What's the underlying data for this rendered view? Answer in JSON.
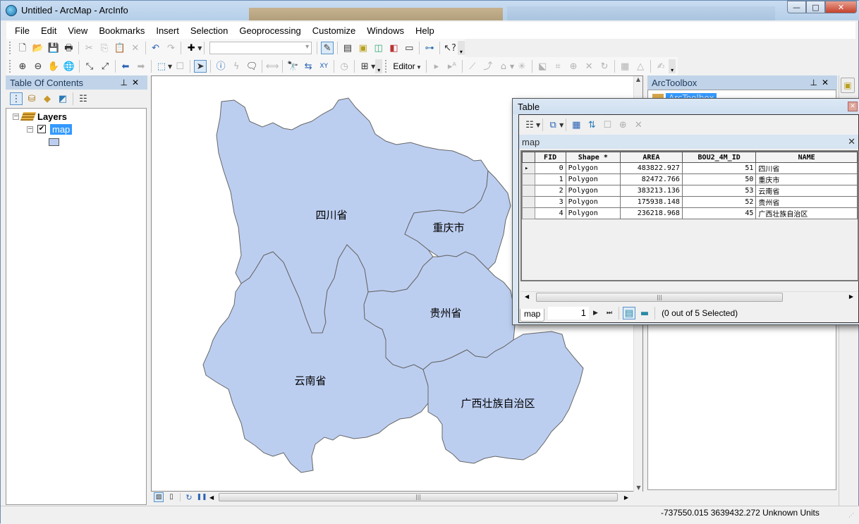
{
  "window": {
    "title": "Untitled - ArcMap - ArcInfo",
    "controls": {
      "minimize": "—",
      "maximize": "□",
      "close": "✕"
    }
  },
  "menu": [
    "File",
    "Edit",
    "View",
    "Bookmarks",
    "Insert",
    "Selection",
    "Geoprocessing",
    "Customize",
    "Windows",
    "Help"
  ],
  "toolbar": {
    "editor_label": "Editor",
    "scale_value": ""
  },
  "toc": {
    "title": "Table Of Contents",
    "root_label": "Layers",
    "layer_label": "map",
    "layer_checked": true,
    "symbol_color": "#bccef0"
  },
  "map": {
    "fill_color": "#bccef0",
    "stroke_color": "#666666",
    "labels": [
      "四川省",
      "重庆市",
      "贵州省",
      "云南省",
      "广西壮族自治区"
    ]
  },
  "toolbox": {
    "title": "ArcToolbox",
    "root_label": "ArcToolbox"
  },
  "table_window": {
    "title": "Table",
    "tab_header": "map",
    "columns": [
      "FID",
      "Shape *",
      "AREA",
      "BOU2_4M_ID",
      "NAME"
    ],
    "rows": [
      {
        "fid": "0",
        "shape": "Polygon",
        "area": "483822.927",
        "bou2": "51",
        "name": "四川省",
        "current": true
      },
      {
        "fid": "1",
        "shape": "Polygon",
        "area": "82472.766",
        "bou2": "50",
        "name": "重庆市",
        "current": false
      },
      {
        "fid": "2",
        "shape": "Polygon",
        "area": "383213.136",
        "bou2": "53",
        "name": "云南省",
        "current": false
      },
      {
        "fid": "3",
        "shape": "Polygon",
        "area": "175938.148",
        "bou2": "52",
        "name": "贵州省",
        "current": false
      },
      {
        "fid": "4",
        "shape": "Polygon",
        "area": "236218.968",
        "bou2": "45",
        "name": "广西壮族自治区",
        "current": false
      }
    ],
    "current_record": "1",
    "selection_status": "(0 out of 5 Selected)",
    "bottom_tab": "map"
  },
  "status": {
    "coordinates": "-737550.015  3639432.272 Unknown Units"
  }
}
